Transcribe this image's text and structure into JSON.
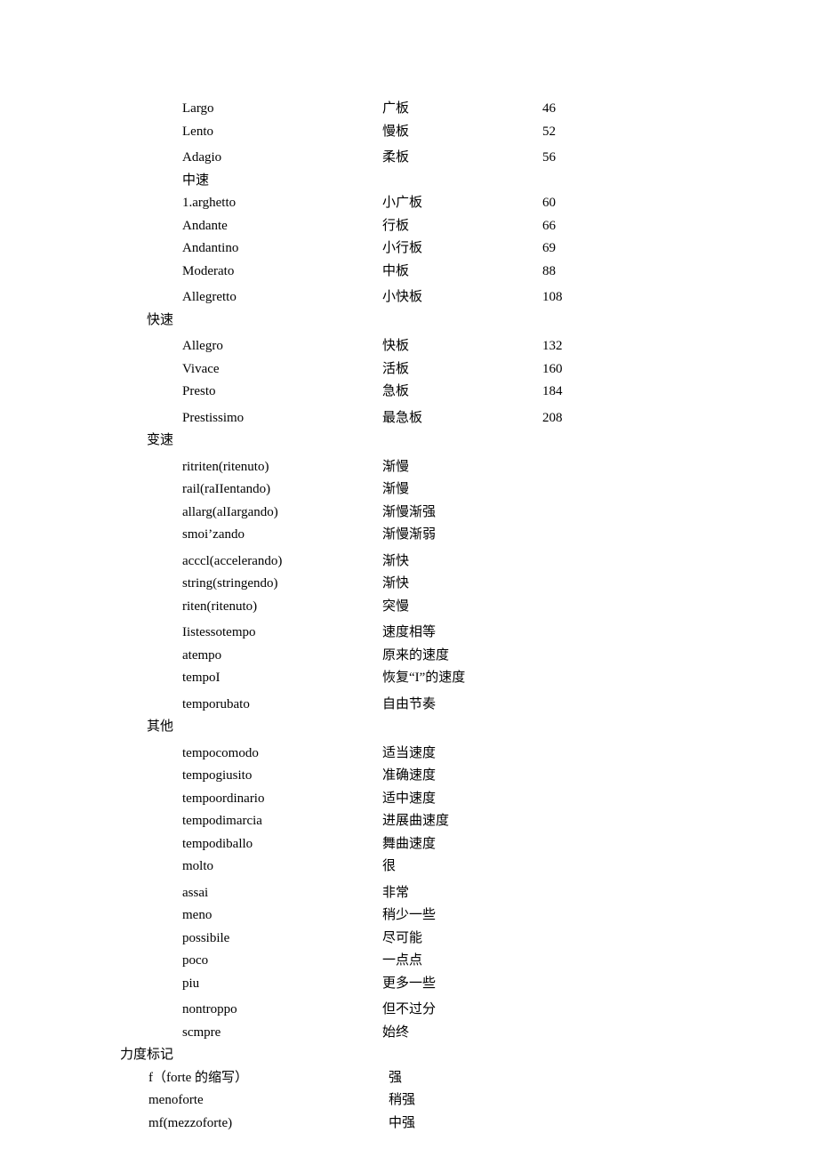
{
  "tempo_slow": [
    {
      "term": "Largo",
      "cn": "广板",
      "bpm": "46"
    },
    {
      "term": "Lento",
      "cn": "慢板",
      "bpm": "52"
    },
    {
      "term": "Adagio",
      "cn": "柔板",
      "bpm": "56"
    }
  ],
  "mid_label": "中速",
  "tempo_mid": [
    {
      "term": "1.arghetto",
      "cn": "小广板",
      "bpm": "60"
    },
    {
      "term": "Andante",
      "cn": "行板",
      "bpm": "66"
    },
    {
      "term": "Andantino",
      "cn": "小行板",
      "bpm": "69"
    },
    {
      "term": "Moderato",
      "cn": "中板",
      "bpm": "88"
    },
    {
      "term": "Allegretto",
      "cn": "小快板",
      "bpm": "108"
    }
  ],
  "fast_label": "快速",
  "tempo_fast": [
    {
      "term": "Allegro",
      "cn": "快板",
      "bpm": "132"
    },
    {
      "term": "Vivace",
      "cn": "活板",
      "bpm": "160"
    },
    {
      "term": "Presto",
      "cn": "急板",
      "bpm": "184"
    },
    {
      "term": "Prestissimo",
      "cn": "最急板",
      "bpm": "208"
    }
  ],
  "change_label": "变速",
  "tempo_change": [
    {
      "term": "ritriten(ritenuto)",
      "cn": "渐慢"
    },
    {
      "term": "rail(raIIentando)",
      "cn": "渐慢"
    },
    {
      "term": "allarg(alIargando)",
      "cn": "渐慢渐强"
    },
    {
      "term": "smoi’zando",
      "cn": "渐慢渐弱"
    },
    {
      "term": "acccl(accelerando)",
      "cn": "渐快"
    },
    {
      "term": "string(stringendo)",
      "cn": "渐快"
    },
    {
      "term": "riten(ritenuto)",
      "cn": "突慢"
    },
    {
      "term": "Iistessotempo",
      "cn": "速度相等"
    },
    {
      "term": "atempo",
      "cn": "原来的速度"
    },
    {
      "term": "tempoI",
      "cn": " 恢复“I”的速度"
    },
    {
      "term": "temporubato",
      "cn": "自由节奏"
    }
  ],
  "other_label": "其他",
  "tempo_other": [
    {
      "term": "tempocomodo",
      "cn": "适当速度"
    },
    {
      "term": "tempogiusito",
      "cn": "准确速度"
    },
    {
      "term": "tempoordinario",
      "cn": "适中速度"
    },
    {
      "term": "tempodimarcia",
      "cn": "进展曲速度"
    },
    {
      "term": "tempodiballo",
      "cn": "舞曲速度"
    },
    {
      "term": "molto",
      "cn": "很"
    },
    {
      "term": "assai",
      "cn": "非常"
    },
    {
      "term": "meno",
      "cn": "稍少一些"
    },
    {
      "term": "possibile",
      "cn": "尽可能"
    },
    {
      "term": "poco",
      "cn": "一点点"
    },
    {
      "term": "piu",
      "cn": "更多一些"
    },
    {
      "term": "nontroppo",
      "cn": "但不过分"
    },
    {
      "term": "scmpre",
      "cn": "始终"
    }
  ],
  "dyn_label": "力度标记",
  "dynamics": [
    {
      "term": "f（forte 的缩写）",
      "cn": "强"
    },
    {
      "term": "menoforte",
      "cn": "稍强"
    },
    {
      "term": "mf(mezzoforte)",
      "cn": "中强"
    }
  ]
}
